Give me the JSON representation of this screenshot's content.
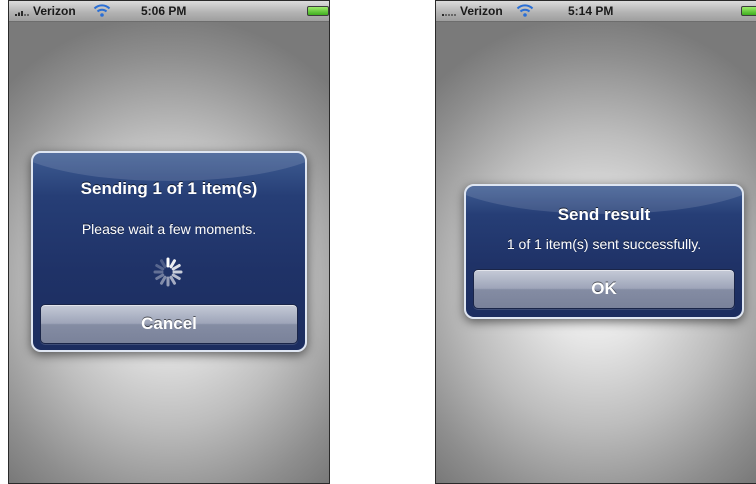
{
  "screens": [
    {
      "status_bar": {
        "carrier": "Verizon",
        "time": "5:06 PM"
      },
      "alert": {
        "title": "Sending 1 of 1 item(s)",
        "message": "Please wait a few moments.",
        "button_label": "Cancel",
        "activity_indicator": "spinner-icon"
      }
    },
    {
      "status_bar": {
        "carrier": "Verizon",
        "time": "5:14 PM"
      },
      "alert": {
        "title": "Send result",
        "message": "1 of 1 item(s) sent successfully.",
        "button_label": "OK"
      }
    }
  ],
  "colors": {
    "alert_background": "#1f3267",
    "alert_border": "#dfe6f2",
    "button_face": "#9ea5b9",
    "battery_fill": "#3fae1f"
  }
}
